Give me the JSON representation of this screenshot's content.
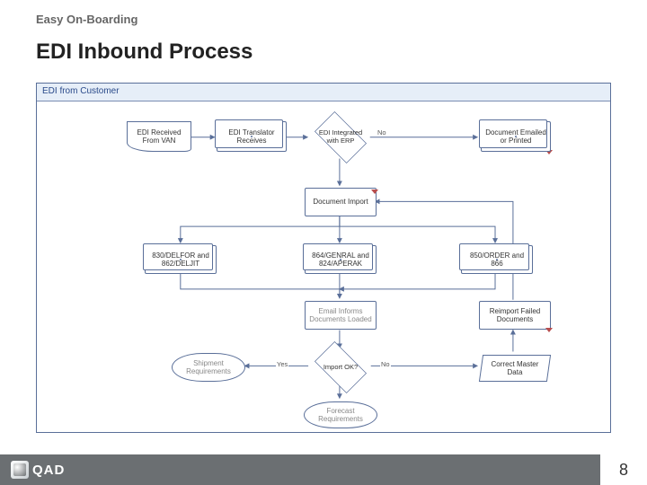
{
  "header": {
    "subtitle": "Easy On-Boarding",
    "title": "EDI Inbound Process"
  },
  "lane": {
    "title": "EDI from Customer"
  },
  "nodes": {
    "edi_received": "EDI Received From VAN",
    "edi_translator": "EDI Translator Receives",
    "edi_integrated_q": "EDI Integrated with ERP",
    "doc_printed": "Document Emailed or Printed",
    "doc_import": "Document Import",
    "n830": "830/DELFOR and 862/DELJIT",
    "n864": "864/GENRAL and 824/APERAK",
    "n850": "850/ORDER and 866",
    "email_informs": "Email Informs Documents Loaded",
    "reimport": "Reimport Failed Documents",
    "shipment_req": "Shipment Requirements",
    "import_ok_q": "Import OK?",
    "correct_master": "Correct Master Data",
    "forecast_req": "Forecast Requirements"
  },
  "edges": {
    "yes": "Yes",
    "no": "No"
  },
  "footer": {
    "brand": "QAD",
    "page": "8"
  }
}
